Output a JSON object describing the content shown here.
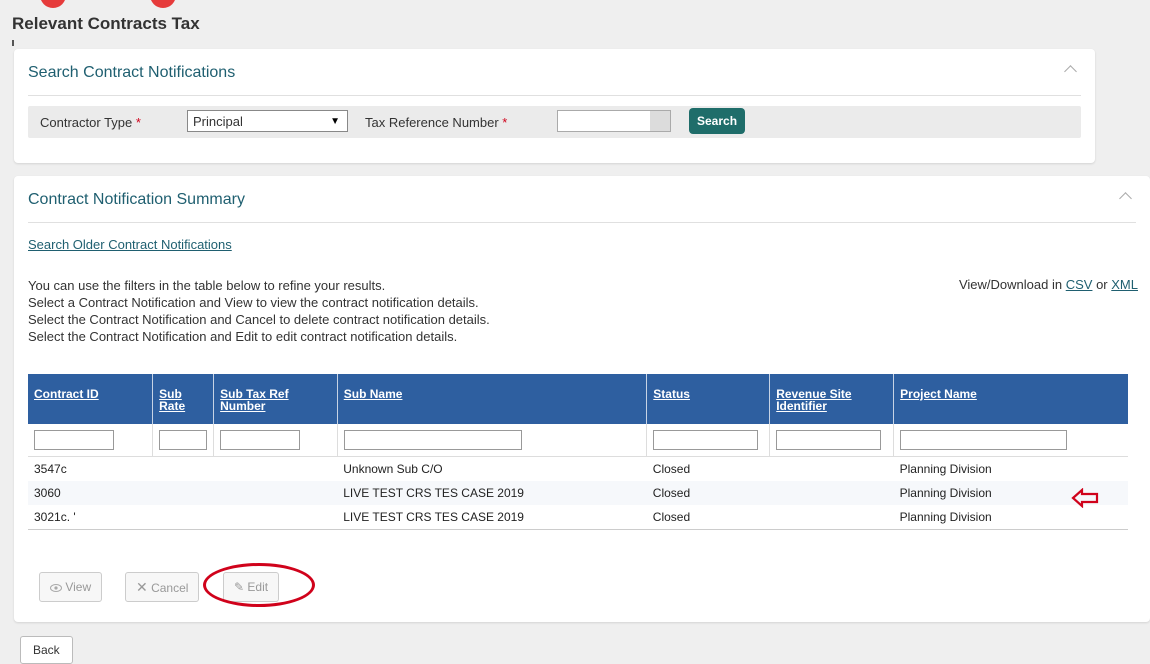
{
  "header": {
    "title": "Relevant Contracts Tax"
  },
  "search_panel": {
    "title": "Search Contract Notifications",
    "contractor_type_label": "Contractor Type",
    "contractor_type_value": "Principal",
    "tax_ref_label": "Tax Reference Number",
    "required_mark": "*",
    "search_button": "Search"
  },
  "summary_panel": {
    "title": "Contract Notification Summary",
    "older_link": "Search Older Contract Notifications",
    "intro_lines": [
      "You can use the filters in the table below to refine your results.",
      "Select a Contract Notification and View to view the contract notification details.",
      "Select the Contract Notification and Cancel to delete contract notification details.",
      "Select the Contract Notification and Edit to edit contract notification details."
    ],
    "download_prefix": "View/Download in",
    "csv_link": "CSV",
    "download_or": "or",
    "xml_link": "XML"
  },
  "table": {
    "columns": [
      {
        "label_line1": "Contract ID",
        "label_line2": ""
      },
      {
        "label_line1": "Sub",
        "label_line2": "Rate"
      },
      {
        "label_line1": "Sub Tax Ref",
        "label_line2": "Number"
      },
      {
        "label_line1": "Sub Name",
        "label_line2": ""
      },
      {
        "label_line1": "Status",
        "label_line2": ""
      },
      {
        "label_line1": "Revenue Site",
        "label_line2": "Identifier"
      },
      {
        "label_line1": "Project Name",
        "label_line2": ""
      }
    ],
    "rows": [
      {
        "contract_id": "3547с",
        "sub_rate": "",
        "sub_tax_ref": "",
        "sub_name": "Unknown Sub C/O",
        "status": "Closed",
        "revenue_site": "",
        "project_name": "Planning Division"
      },
      {
        "contract_id": "3060",
        "sub_rate": "",
        "sub_tax_ref": "",
        "sub_name": "LIVE TEST CRS TES CASE 2019",
        "status": "Closed",
        "revenue_site": "",
        "project_name": "Planning Division"
      },
      {
        "contract_id": "3021с. '",
        "sub_rate": "",
        "sub_tax_ref": "",
        "sub_name": "LIVE TEST CRS TES CASE 2019",
        "status": "Closed",
        "revenue_site": "",
        "project_name": "Planning Division"
      }
    ]
  },
  "actions": {
    "view": "View",
    "cancel": "Cancel",
    "edit": "Edit"
  },
  "footer": {
    "back": "Back"
  },
  "colors": {
    "accent": "#1f5f70",
    "table_header": "#2e5fa0",
    "search_button": "#1f6d6a",
    "annotation": "#d0021b"
  },
  "icons": {
    "collapse": "chevron-up-icon",
    "view": "eye-icon",
    "cancel": "x-icon",
    "edit": "pencil-icon",
    "annotation_arrow": "arrow-left-icon"
  }
}
